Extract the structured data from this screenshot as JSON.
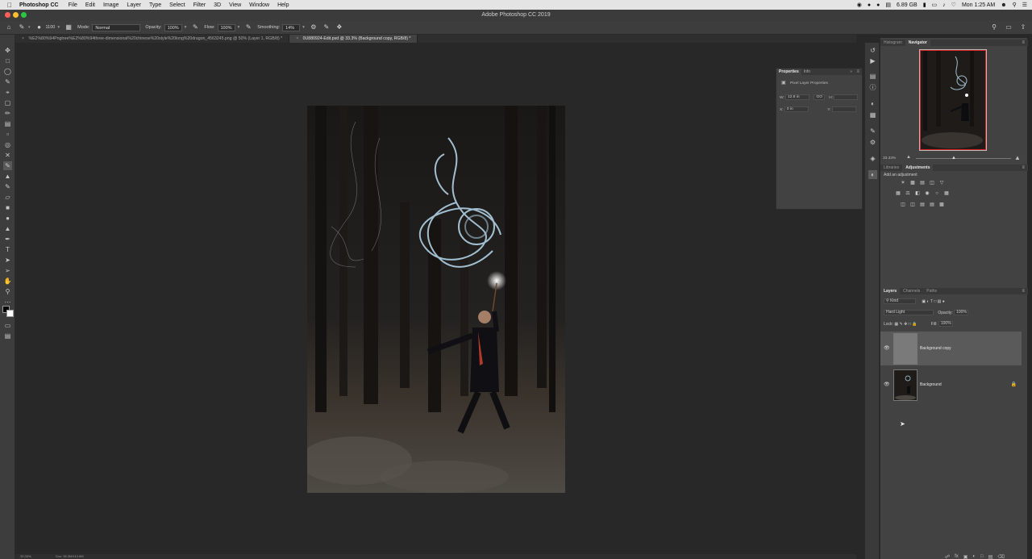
{
  "menubar": {
    "app_name": "Photoshop CC",
    "items": [
      "File",
      "Edit",
      "Image",
      "Layer",
      "Type",
      "Select",
      "Filter",
      "3D",
      "View",
      "Window",
      "Help"
    ],
    "memory": "6.89 GB",
    "clock": "Mon 1:25 AM"
  },
  "titlebar": {
    "title": "Adobe Photoshop CC 2019"
  },
  "options": {
    "brush_size": "1100",
    "mode_label": "Mode:",
    "mode_value": "Normal",
    "opacity_label": "Opacity:",
    "opacity_value": "100%",
    "flow_label": "Flow:",
    "flow_value": "100%",
    "smoothing_label": "Smoothing:",
    "smoothing_value": "14%"
  },
  "tabs": [
    {
      "label": "%E2%80%94Pngtree%E2%80%94three-dimensional%20chinese%20style%20long%20dragon_4563245.png @ 50% (Layer 1, RGB/8) *"
    },
    {
      "label": "0U880924-Edit.psd @ 33.3% (Background copy, RGB/8) *"
    }
  ],
  "properties": {
    "tabs": [
      "Properties",
      "Info"
    ],
    "heading": "Pixel Layer Properties",
    "w_label": "W:",
    "w_value": "12.8 in",
    "link": "GO",
    "h_label": "H:",
    "x_label": "X:",
    "x_value": "0 in",
    "y_label": "Y:"
  },
  "navigator": {
    "tabs": [
      "Histogram",
      "Navigator"
    ],
    "zoom": "33.33%"
  },
  "adjustments": {
    "tabs": [
      "Libraries",
      "Adjustments"
    ],
    "prompt": "Add an adjustment"
  },
  "layers": {
    "tabs": [
      "Layers",
      "Channels",
      "Paths"
    ],
    "kind": "Kind",
    "blend_mode": "Hard Light",
    "opacity_label": "Opacity:",
    "opacity_value": "100%",
    "lock_label": "Lock:",
    "fill_label": "Fill:",
    "fill_value": "100%",
    "items": [
      {
        "name": "Background copy"
      },
      {
        "name": "Background"
      }
    ]
  },
  "status": {
    "zoom": "33.33%",
    "doc": "Doc: 55.3M/110.6M"
  },
  "colors": {
    "accent": "#e02020",
    "panel": "#424242",
    "canvas": "#282828"
  }
}
